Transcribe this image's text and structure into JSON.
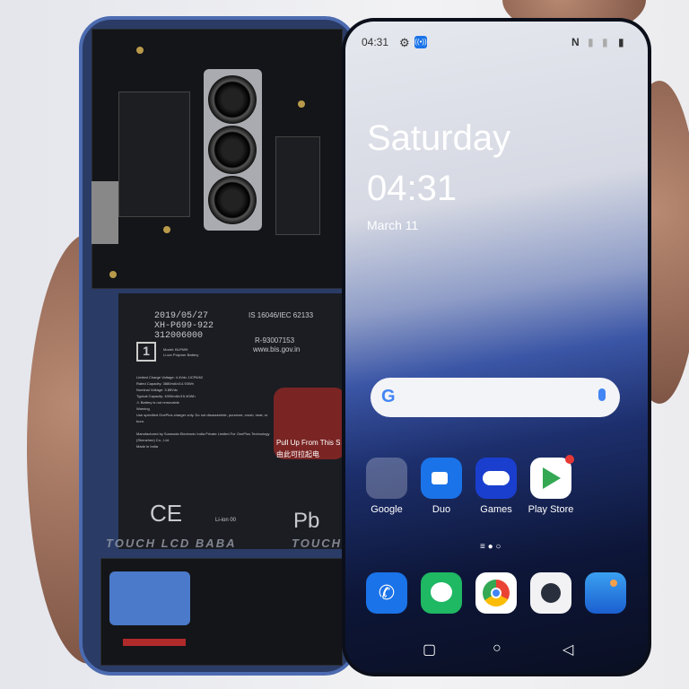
{
  "phone_back": {
    "battery": {
      "date_code": "2019/05/27",
      "serial_1": "XH-P699-922",
      "serial_2": "312006000",
      "standard": "IS 16046/IEC 62133",
      "registration": "R-93007153",
      "website": "www.bis.gov.in",
      "model": "Model: BLP699",
      "type": "Li-ion Polymer Battery",
      "spec_1": "Limited Charge Voltage: 4.4Vdc",
      "spec_2": "Rated Capacity: 3880mAh/14.93Wh",
      "spec_3": "Nominal Voltage: 3.85Vdc",
      "spec_4": "Typical Capacity: 4000mAh/15.40Wh",
      "cell_code": "1ICP6/62",
      "warning_1": "Battery is not removable",
      "warning_2": "Warning",
      "warning_3": "Use specified OnePlus charger only. Do not disassemble, puncture, crush, heat, or burn.",
      "maker": "Manufactured by Sunwoda Electronic India Private Limited For OnePlus Technology (Shenzhen) Co., Ltd.",
      "origin": "Made in India",
      "ce": "CE",
      "li_ion": "Li-ion 00",
      "pb": "Pb",
      "pull_tab_en": "Pull Up From This S",
      "pull_tab_cn": "由此可拉起电"
    }
  },
  "watermark": "TOUCH LCD BABA",
  "status_bar": {
    "time": "04:31",
    "icons": [
      "gear-icon",
      "cast-icon",
      "nfc-icon",
      "no-sim-icon",
      "no-sim-icon",
      "battery-icon"
    ]
  },
  "lock_clock": {
    "day": "Saturday",
    "time": "04:31",
    "date": "March 11"
  },
  "search_bar": {
    "logo": "G",
    "mic_icon": "mic-icon"
  },
  "apps": [
    {
      "label": "Google"
    },
    {
      "label": "Duo"
    },
    {
      "label": "Games"
    },
    {
      "label": "Play Store"
    }
  ],
  "dock": [
    "phone",
    "messages",
    "chrome",
    "camera",
    "gallery"
  ],
  "colors": {
    "accent": "#1a73e8",
    "badge": "#e53935"
  }
}
